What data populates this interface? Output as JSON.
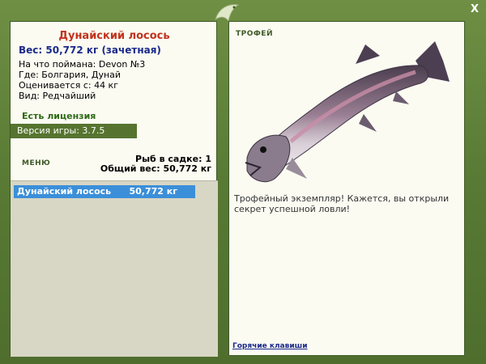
{
  "window": {
    "close_label": "X"
  },
  "fish": {
    "name": "Дунайский лосось",
    "weight_line": "Вес: 50,772 кг (зачетная)",
    "bait_line": "На что поймана: Devon №3",
    "place_line": "Где: Болгария, Дунай",
    "value_line": "Оценивается с: 44 кг",
    "kind_line": "Вид: Редчайший"
  },
  "license": "Есть лицензия",
  "version": "Версия игры: 3.7.5",
  "menu_label": "МЕНЮ",
  "stats": {
    "fish_in_net": "Рыб в садке: 1",
    "total_weight": "Общий вес: 50,772 кг"
  },
  "catch_list": [
    {
      "name": "Дунайский лосось",
      "weight": "50,772 кг"
    }
  ],
  "trophy": {
    "label": "ТРОФЕЙ",
    "text": "Трофейный экземпляр! Кажется, вы открыли секрет успешной ловли!"
  },
  "hotkeys": "Горячие клавиши",
  "colors": {
    "accent_green": "#56742f",
    "selection_blue": "#3b8fd9",
    "title_red": "#c3321c"
  }
}
